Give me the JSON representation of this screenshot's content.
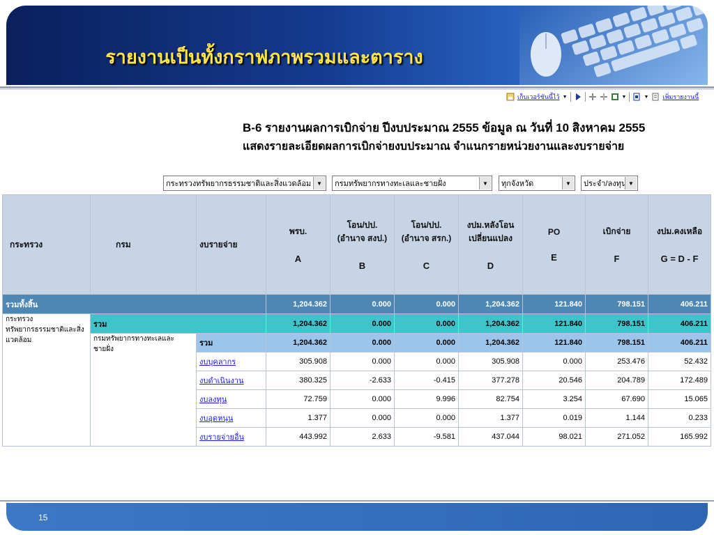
{
  "slide": {
    "title": "รายงานเป็นทั้งกราฟภาพรวมและตาราง",
    "page_number": "15"
  },
  "toolbar": {
    "save_version": "เก็บเวอร์ชันนี้ไว้",
    "add_report": "เพิ่มรายงานนี้"
  },
  "report": {
    "title": "B-6 รายงานผลการเบิกจ่าย ปีงบประมาณ 2555 ข้อมูล ณ วันที่ 10 สิงหาคม 2555",
    "subtitle": "แสดงรายละเอียดผลการเบิกจ่ายงบประมาณ จำแนกรายหน่วยงานและงบรายจ่าย"
  },
  "filters": {
    "ministry": "กระทรวงทรัพยากรธรรมชาติและสิ่งแวดล้อม",
    "department": "กรมทรัพยากรทางทะเลและชายฝั่ง",
    "province": "ทุกจังหวัด",
    "budget_type": "ประจำ/ลงทุน"
  },
  "table": {
    "headers": {
      "ministry": "กระทรวง",
      "department": "กรม",
      "expense": "งบรายจ่าย",
      "a": "พรบ.",
      "b": "โอน/ปป.\n(อำนาจ สงป.)",
      "c": "โอน/ปป.\n(อำนาจ สรก.)",
      "d": "งปม.หลังโอน\nเปลี่ยนแปลง",
      "e": "PO",
      "f": "เบิกจ่าย",
      "g": "งปม.คงเหลือ"
    },
    "codes": {
      "a": "A",
      "b": "B",
      "c": "C",
      "d": "D",
      "e": "E",
      "f": "F",
      "g": "G = D - F"
    },
    "total": {
      "label": "รวมทั้งสิ้น",
      "a": "1,204.362",
      "b": "0.000",
      "c": "0.000",
      "d": "1,204.362",
      "e": "121.840",
      "f": "798.151",
      "g": "406.211"
    },
    "ministry_row": {
      "name": "กระทรวงทรัพยากรธรรมชาติและสิ่งแวดล้อม",
      "label": "รวม",
      "a": "1,204.362",
      "b": "0.000",
      "c": "0.000",
      "d": "1,204.362",
      "e": "121.840",
      "f": "798.151",
      "g": "406.211"
    },
    "department_row": {
      "name": "กรมทรัพยากรทางทะเลและชายฝั่ง",
      "label": "รวม",
      "a": "1,204.362",
      "b": "0.000",
      "c": "0.000",
      "d": "1,204.362",
      "e": "121.840",
      "f": "798.151",
      "g": "406.211"
    },
    "items": [
      {
        "name": "งบบุคลากร",
        "a": "305.908",
        "b": "0.000",
        "c": "0.000",
        "d": "305.908",
        "e": "0.000",
        "f": "253.476",
        "g": "52.432"
      },
      {
        "name": "งบดำเนินงาน",
        "a": "380.325",
        "b": "-2.633",
        "c": "-0.415",
        "d": "377.278",
        "e": "20.546",
        "f": "204.789",
        "g": "172.489"
      },
      {
        "name": "งบลงทุน",
        "a": "72.759",
        "b": "0.000",
        "c": "9.996",
        "d": "82.754",
        "e": "3.254",
        "f": "67.690",
        "g": "15.065"
      },
      {
        "name": "งบอุดหนุน",
        "a": "1.377",
        "b": "0.000",
        "c": "0.000",
        "d": "1.377",
        "e": "0.019",
        "f": "1.144",
        "g": "0.233"
      },
      {
        "name": "งบรายจ่ายอื่น",
        "a": "443.992",
        "b": "2.633",
        "c": "-9.581",
        "d": "437.044",
        "e": "98.021",
        "f": "271.052",
        "g": "165.992"
      }
    ]
  }
}
